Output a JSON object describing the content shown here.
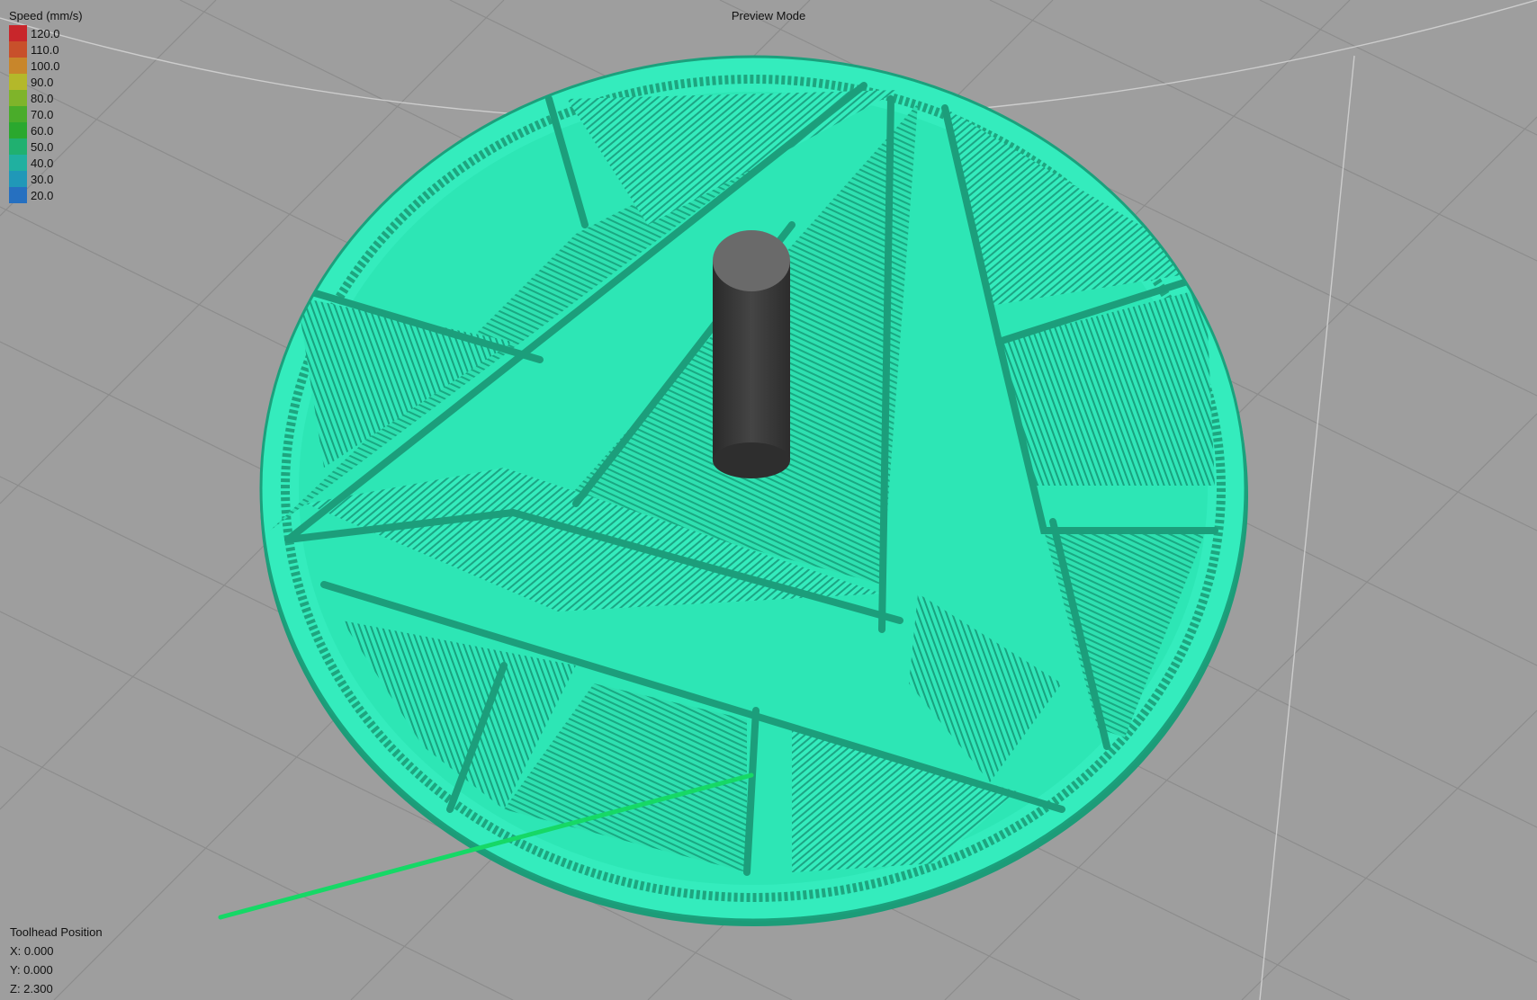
{
  "header": {
    "title": "Preview Mode"
  },
  "legend": {
    "title": "Speed (mm/s)",
    "items": [
      {
        "label": "120.0",
        "color": "#c8262b"
      },
      {
        "label": "110.0",
        "color": "#c8502b"
      },
      {
        "label": "100.0",
        "color": "#c8862b"
      },
      {
        "label": "90.0",
        "color": "#b4b82a"
      },
      {
        "label": "80.0",
        "color": "#7fb42a"
      },
      {
        "label": "70.0",
        "color": "#4aac2a"
      },
      {
        "label": "60.0",
        "color": "#2aa82e"
      },
      {
        "label": "50.0",
        "color": "#20b070"
      },
      {
        "label": "40.0",
        "color": "#20b0a0"
      },
      {
        "label": "30.0",
        "color": "#2098b8"
      },
      {
        "label": "20.0",
        "color": "#2670c0"
      }
    ]
  },
  "toolhead": {
    "title": "Toolhead Position",
    "x": "X: 0.000",
    "y": "Y: 0.000",
    "z": "Z: 2.300"
  },
  "colors": {
    "background": "#9e9e9e",
    "grid": "#8a8a8a",
    "print": "#2ee8b6",
    "travel": "#18e06a",
    "pin": "#3a3a3a"
  }
}
